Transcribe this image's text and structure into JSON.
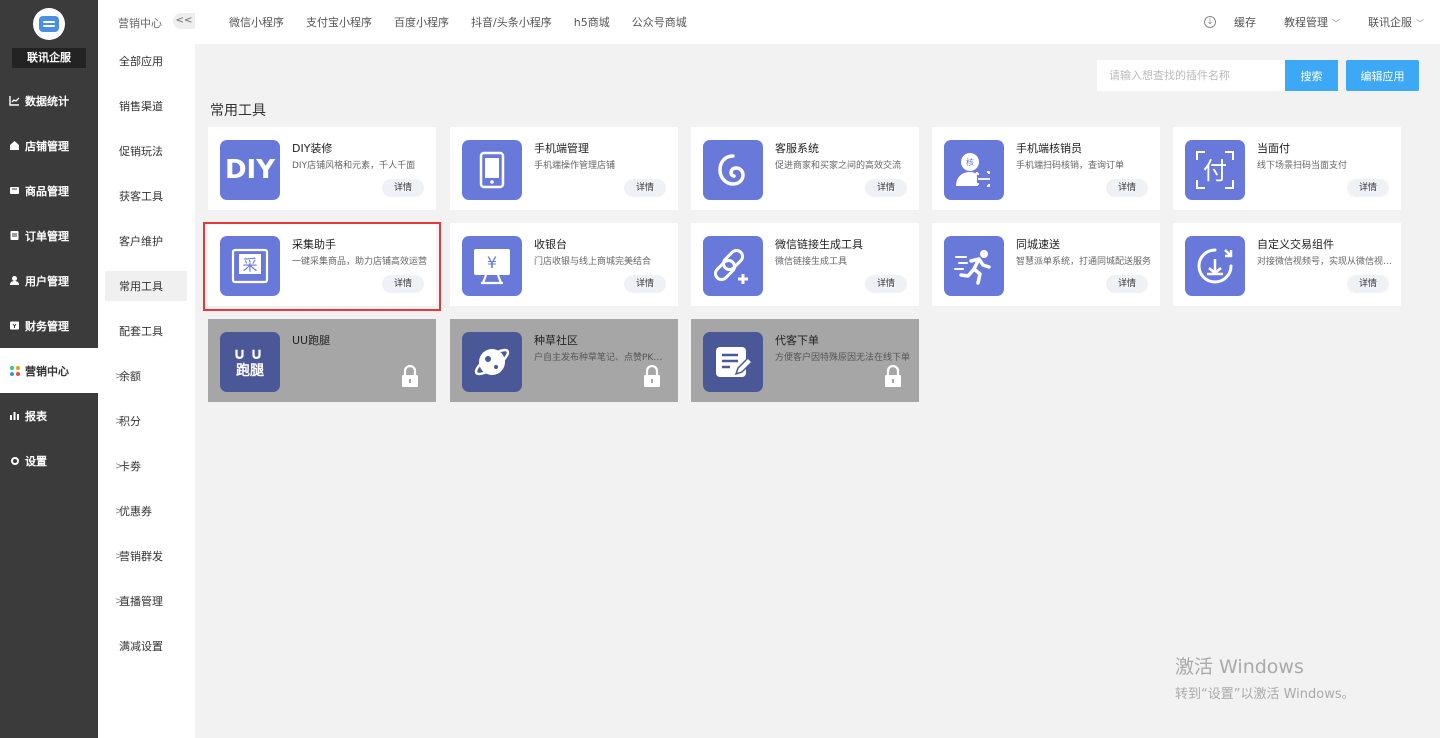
{
  "brand": {
    "name": "联讯企服"
  },
  "sidebar": {
    "items": [
      {
        "label": "数据统计",
        "icon": "chart-line-icon"
      },
      {
        "label": "店铺管理",
        "icon": "home-icon"
      },
      {
        "label": "商品管理",
        "icon": "product-icon"
      },
      {
        "label": "订单管理",
        "icon": "order-icon"
      },
      {
        "label": "用户管理",
        "icon": "user-icon"
      },
      {
        "label": "财务管理",
        "icon": "finance-icon"
      },
      {
        "label": "营销中心",
        "icon": "marketing-pinwheel-icon",
        "active": true
      },
      {
        "label": "报表",
        "icon": "report-bars-icon"
      },
      {
        "label": "设置",
        "icon": "gear-icon"
      }
    ]
  },
  "submenu": {
    "title": "营销中心",
    "collapse": "<<",
    "items": [
      {
        "label": "全部应用"
      },
      {
        "label": "销售渠道"
      },
      {
        "label": "促销玩法"
      },
      {
        "label": "获客工具"
      },
      {
        "label": "客户维护"
      },
      {
        "label": "常用工具",
        "active": true
      },
      {
        "label": "配套工具"
      },
      {
        "label": "余额",
        "arrow": ">"
      },
      {
        "label": "积分",
        "arrow": ">"
      },
      {
        "label": "卡劵",
        "arrow": ">"
      },
      {
        "label": "优惠券",
        "arrow": ">"
      },
      {
        "label": "营销群发",
        "arrow": ">"
      },
      {
        "label": "直播管理",
        "arrow": ">"
      },
      {
        "label": "满减设置"
      }
    ]
  },
  "topbar": {
    "tabs": [
      "微信小程序",
      "支付宝小程序",
      "百度小程序",
      "抖音/头条小程序",
      "h5商城",
      "公众号商城"
    ],
    "cache": "缓存",
    "tutorial": "教程管理",
    "account": "联讯企服",
    "download_icon": "download-icon"
  },
  "search": {
    "placeholder": "请输入想查找的插件名称",
    "button": "搜索"
  },
  "edit_button": "编辑应用",
  "section_title": "常用工具",
  "detail_label": "详情",
  "colors": {
    "accent": "#3da8f5",
    "icon_bg": "#6979d9",
    "locked_bg": "#a6a6a6",
    "highlight": "#e53935"
  },
  "cards": [
    {
      "name": "DIY装修",
      "desc": "DIY店铺风格和元素，千人千面",
      "icon": "diy-icon",
      "icon_text": "DIY"
    },
    {
      "name": "手机端管理",
      "desc": "手机端操作管理店铺",
      "icon": "phone-icon"
    },
    {
      "name": "客服系统",
      "desc": "促进商家和买家之间的高效交流",
      "icon": "customer-service-icon"
    },
    {
      "name": "手机端核销员",
      "desc": "手机端扫码核销，查询订单",
      "icon": "verify-staff-icon",
      "icon_text": "核"
    },
    {
      "name": "当面付",
      "desc": "线下场景扫码当面支付",
      "icon": "face-pay-icon",
      "icon_text": "付"
    },
    {
      "name": "采集助手",
      "desc": "一键采集商品，助力店铺高效运营",
      "icon": "collect-icon",
      "icon_text": "采"
    },
    {
      "name": "收银台",
      "desc": "门店收银与线上商城完美结合",
      "icon": "cashier-icon",
      "icon_text": "¥"
    },
    {
      "name": "微信链接生成工具",
      "desc": "微信链接生成工具",
      "icon": "link-add-icon"
    },
    {
      "name": "同城速送",
      "desc": "智慧派单系统，打通同城配送服务",
      "icon": "runner-icon"
    },
    {
      "name": "自定义交易组件",
      "desc": "对接微信视频号，实现从微信视频号带货",
      "icon": "trade-component-icon"
    },
    {
      "name": "UU跑腿",
      "desc": "",
      "icon": "uu-paotui-icon",
      "icon_text": "跑腿",
      "locked": true
    },
    {
      "name": "种草社区",
      "desc": "户自主发布种草笔记、点赞PK…",
      "icon": "planet-icon",
      "locked": true
    },
    {
      "name": "代客下单",
      "desc": "方便客户因特殊原因无法在线下单",
      "icon": "edit-note-icon",
      "locked": true
    }
  ],
  "watermark": {
    "line1": "激活 Windows",
    "line2": "转到“设置”以激活 Windows。"
  }
}
